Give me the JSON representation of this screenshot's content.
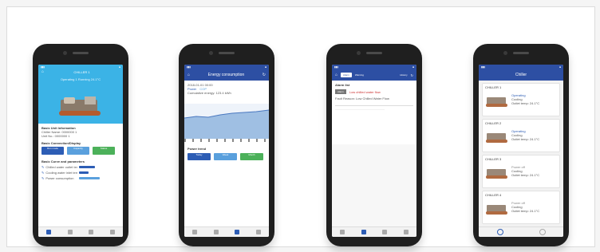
{
  "phone1": {
    "header_title": "CHILLER 1",
    "header_sub": "Operating    1 Running    24.1°C",
    "sections": [
      {
        "title": "Basic Unit Information",
        "lines": [
          "Chiller Name: 0000000 1",
          "Unit No.: 0000000 1"
        ]
      },
      {
        "title": "Basic Connection/Display"
      },
      {
        "title": "Basic Curve and parameters"
      }
    ],
    "buttons": [
      {
        "label": "Run mode",
        "color": "#2d5db5"
      },
      {
        "label": "Capacity",
        "color": "#5aa0dd"
      },
      {
        "label": "Status",
        "color": "#4cb15a"
      }
    ],
    "curve_rows": [
      {
        "label": "Chilled water outlet temp",
        "fill": 0.6
      },
      {
        "label": "Cooling water inlet temp",
        "fill": 0.35
      },
      {
        "label": "Power consumption",
        "fill": 0.8
      }
    ],
    "nav": [
      "Overview",
      "Curve",
      "Alarm",
      "Me"
    ]
  },
  "phone2": {
    "title": "Energy consumption",
    "date": "2018-01-01 00:00",
    "legend": [
      "Power",
      "COP"
    ],
    "info": "Cumulative energy: 123.4 kWh",
    "chart_label": "Power trend",
    "buttons": [
      {
        "label": "Today",
        "color": "#2d5db5"
      },
      {
        "label": "Week",
        "color": "#5aa0dd"
      },
      {
        "label": "Month",
        "color": "#4cb15a"
      }
    ],
    "nav": [
      "Overview",
      "Curve",
      "Energy",
      "Me"
    ]
  },
  "phone3": {
    "tabs": [
      "Alarm",
      "Warning",
      "History"
    ],
    "section": "Alarm list",
    "alarm_tag": "Alarm",
    "alarm_text": "Low chilled water flow",
    "alarm_detail": "Fault Reason: Low Chilled Water Flow",
    "note": "--------------------------------------------------------------",
    "nav": [
      "Overview",
      "Alarm",
      "Curve",
      "Me"
    ]
  },
  "phone4": {
    "title": "Chiller",
    "cards": [
      {
        "name": "CHILLER 1",
        "status": "Operating",
        "mode": "Cooling",
        "extra": "Outlet temp: 24.1°C",
        "status_color": "#2d5db5"
      },
      {
        "name": "CHILLER 2",
        "status": "Operating",
        "mode": "Cooling",
        "extra": "Outlet temp: 24.1°C",
        "status_color": "#2d5db5"
      },
      {
        "name": "CHILLER 3",
        "status": "Power off",
        "mode": "Cooling",
        "extra": "Outlet temp: 24.1°C",
        "status_color": "#888888"
      },
      {
        "name": "CHILLER 4",
        "status": "Power off",
        "mode": "Cooling",
        "extra": "Outlet temp: 24.1°C",
        "status_color": "#888888"
      }
    ],
    "nav": [
      "Chiller",
      "Me"
    ]
  }
}
